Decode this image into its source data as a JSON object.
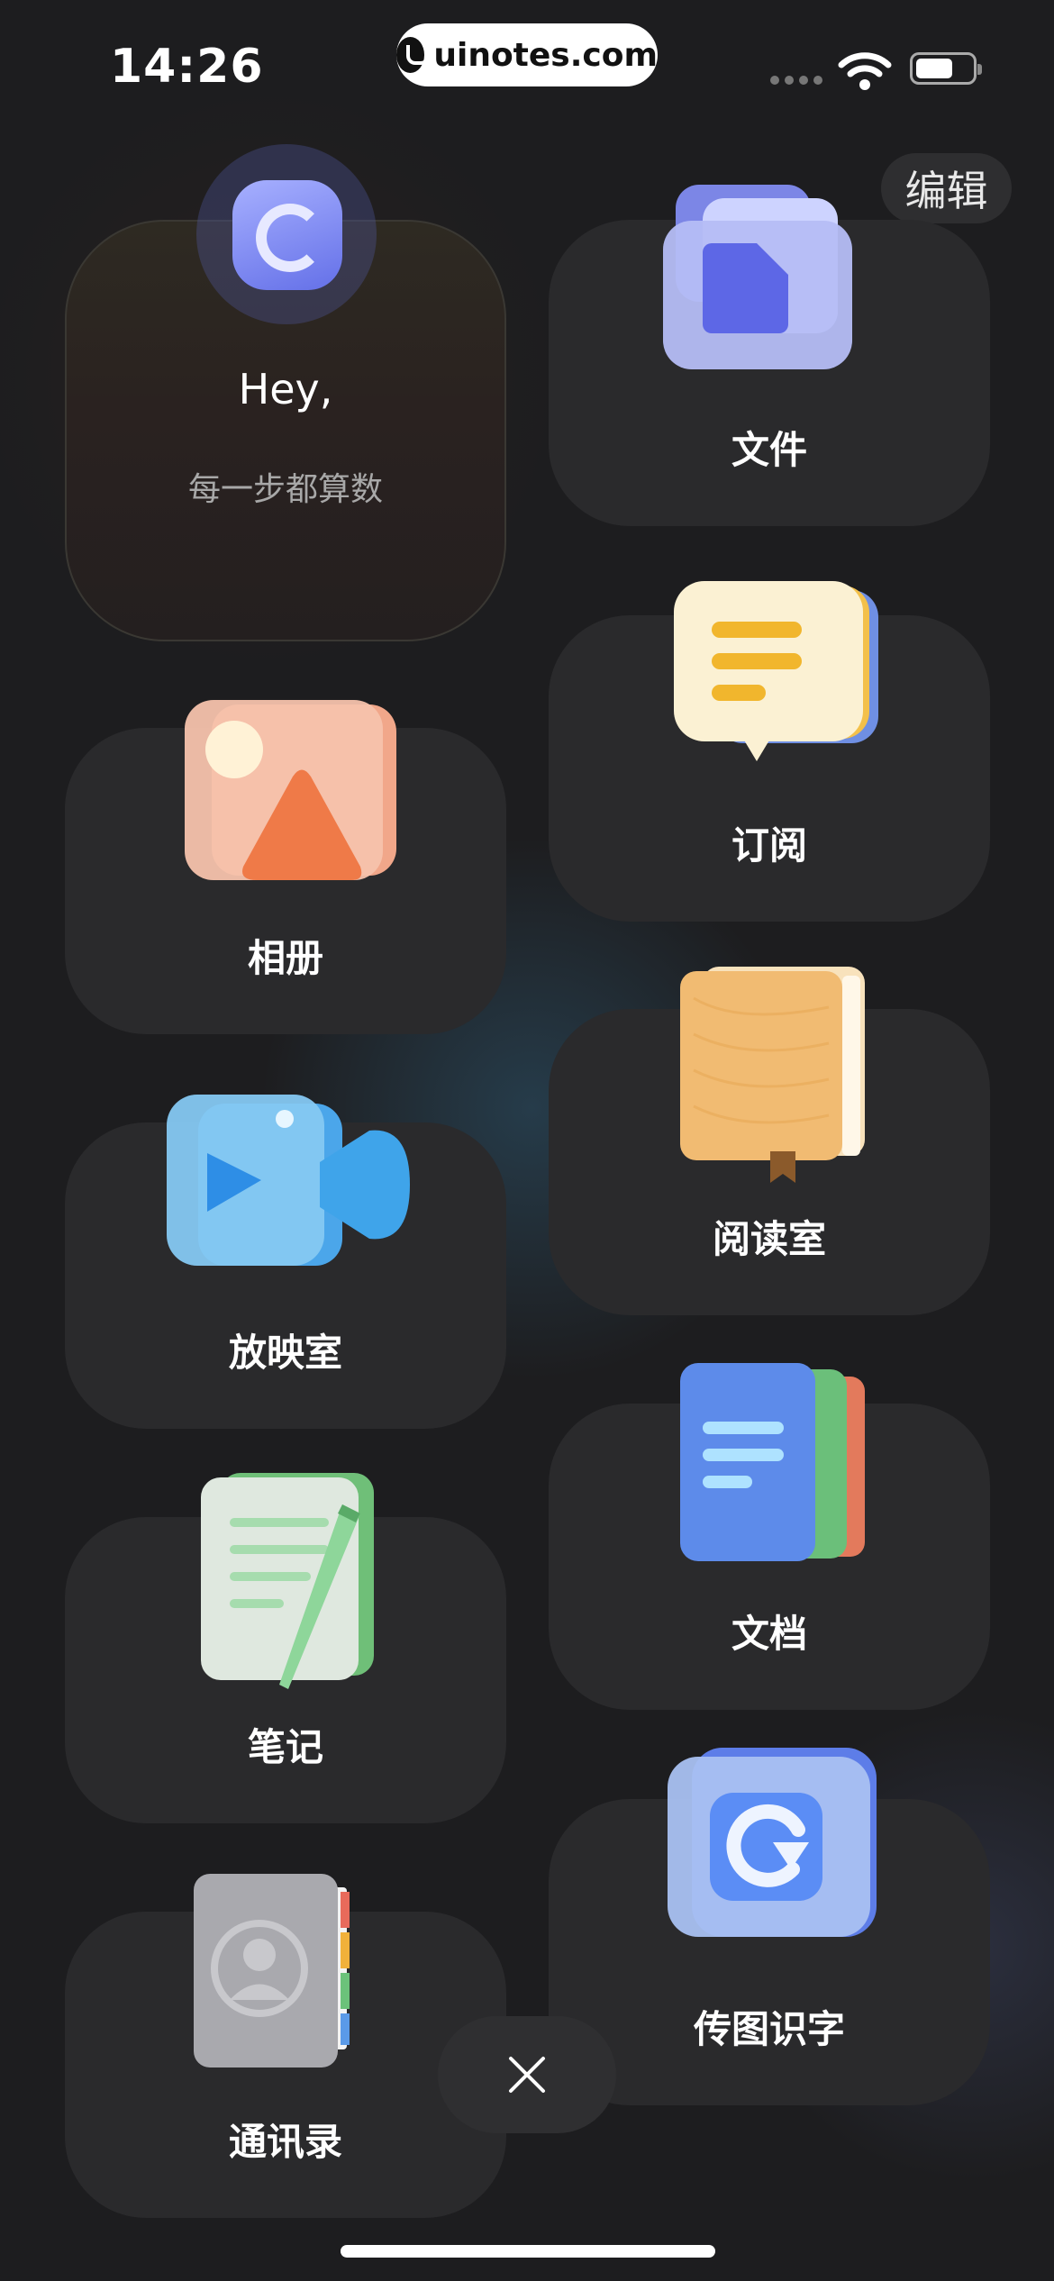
{
  "status_bar": {
    "time": "14:26",
    "url": "uinotes.com"
  },
  "header": {
    "edit_label": "编辑"
  },
  "hey_card": {
    "title": "Hey,",
    "subtitle": "每一步都算数"
  },
  "tiles": {
    "files": "文件",
    "subscribe": "订阅",
    "album": "相册",
    "reading_room": "阅读室",
    "screening_room": "放映室",
    "documents": "文档",
    "notes": "笔记",
    "image_ocr": "传图识字",
    "contacts": "通讯录"
  },
  "icons": {
    "files": "folder-icon",
    "subscribe": "chat-bubble-icon",
    "album": "photo-icon",
    "reading_room": "book-icon",
    "screening_room": "video-camera-icon",
    "documents": "document-icon",
    "notes": "notepad-pen-icon",
    "image_ocr": "ocr-icon",
    "contacts": "contacts-book-icon",
    "close": "close-icon"
  }
}
